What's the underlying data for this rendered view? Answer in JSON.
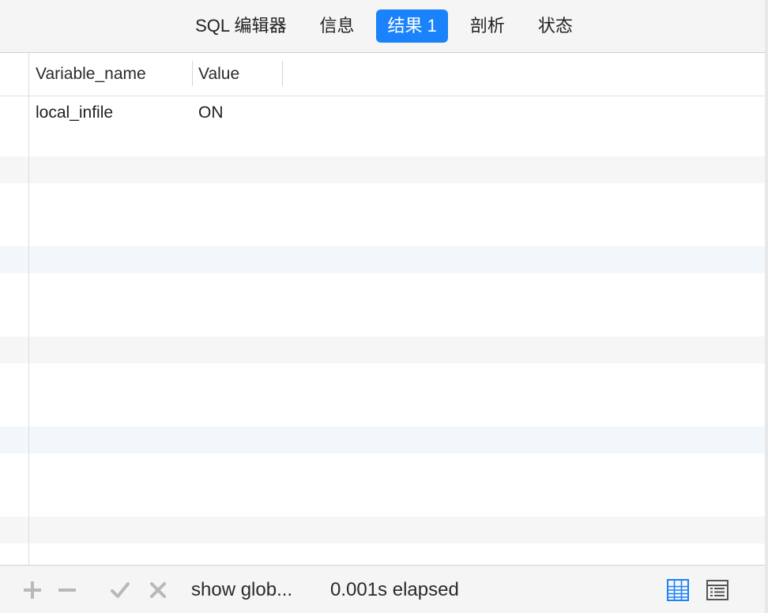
{
  "tabs": [
    {
      "label": "SQL 编辑器",
      "active": false
    },
    {
      "label": "信息",
      "active": false
    },
    {
      "label": "结果 1",
      "active": true
    },
    {
      "label": "剖析",
      "active": false
    },
    {
      "label": "状态",
      "active": false
    }
  ],
  "grid": {
    "columns": [
      "Variable_name",
      "Value"
    ],
    "rows": [
      [
        "local_infile",
        "ON"
      ]
    ]
  },
  "statusbar": {
    "query": "show glob...",
    "elapsed": "0.001s elapsed"
  },
  "icons": {
    "add": "plus-icon",
    "remove": "minus-icon",
    "apply": "check-icon",
    "discard": "x-icon",
    "grid_view": "grid-view-icon",
    "form_view": "form-view-icon"
  },
  "colors": {
    "accent": "#1a82fb",
    "stripe_gray": "#f6f6f6",
    "stripe_blue": "#f2f7fc",
    "toolbar_bg": "#f5f5f5",
    "disabled_icon": "#b8b8b8"
  }
}
